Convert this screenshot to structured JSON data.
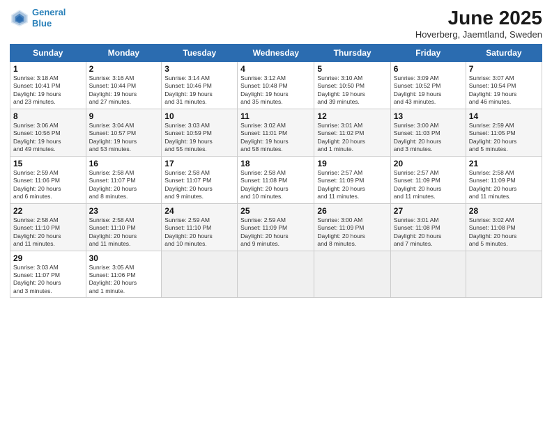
{
  "header": {
    "logo_line1": "General",
    "logo_line2": "Blue",
    "month": "June 2025",
    "location": "Hoverberg, Jaemtland, Sweden"
  },
  "weekdays": [
    "Sunday",
    "Monday",
    "Tuesday",
    "Wednesday",
    "Thursday",
    "Friday",
    "Saturday"
  ],
  "weeks": [
    [
      {
        "day": "1",
        "info": "Sunrise: 3:18 AM\nSunset: 10:41 PM\nDaylight: 19 hours\nand 23 minutes."
      },
      {
        "day": "2",
        "info": "Sunrise: 3:16 AM\nSunset: 10:44 PM\nDaylight: 19 hours\nand 27 minutes."
      },
      {
        "day": "3",
        "info": "Sunrise: 3:14 AM\nSunset: 10:46 PM\nDaylight: 19 hours\nand 31 minutes."
      },
      {
        "day": "4",
        "info": "Sunrise: 3:12 AM\nSunset: 10:48 PM\nDaylight: 19 hours\nand 35 minutes."
      },
      {
        "day": "5",
        "info": "Sunrise: 3:10 AM\nSunset: 10:50 PM\nDaylight: 19 hours\nand 39 minutes."
      },
      {
        "day": "6",
        "info": "Sunrise: 3:09 AM\nSunset: 10:52 PM\nDaylight: 19 hours\nand 43 minutes."
      },
      {
        "day": "7",
        "info": "Sunrise: 3:07 AM\nSunset: 10:54 PM\nDaylight: 19 hours\nand 46 minutes."
      }
    ],
    [
      {
        "day": "8",
        "info": "Sunrise: 3:06 AM\nSunset: 10:56 PM\nDaylight: 19 hours\nand 49 minutes."
      },
      {
        "day": "9",
        "info": "Sunrise: 3:04 AM\nSunset: 10:57 PM\nDaylight: 19 hours\nand 53 minutes."
      },
      {
        "day": "10",
        "info": "Sunrise: 3:03 AM\nSunset: 10:59 PM\nDaylight: 19 hours\nand 55 minutes."
      },
      {
        "day": "11",
        "info": "Sunrise: 3:02 AM\nSunset: 11:01 PM\nDaylight: 19 hours\nand 58 minutes."
      },
      {
        "day": "12",
        "info": "Sunrise: 3:01 AM\nSunset: 11:02 PM\nDaylight: 20 hours\nand 1 minute."
      },
      {
        "day": "13",
        "info": "Sunrise: 3:00 AM\nSunset: 11:03 PM\nDaylight: 20 hours\nand 3 minutes."
      },
      {
        "day": "14",
        "info": "Sunrise: 2:59 AM\nSunset: 11:05 PM\nDaylight: 20 hours\nand 5 minutes."
      }
    ],
    [
      {
        "day": "15",
        "info": "Sunrise: 2:59 AM\nSunset: 11:06 PM\nDaylight: 20 hours\nand 6 minutes."
      },
      {
        "day": "16",
        "info": "Sunrise: 2:58 AM\nSunset: 11:07 PM\nDaylight: 20 hours\nand 8 minutes."
      },
      {
        "day": "17",
        "info": "Sunrise: 2:58 AM\nSunset: 11:07 PM\nDaylight: 20 hours\nand 9 minutes."
      },
      {
        "day": "18",
        "info": "Sunrise: 2:58 AM\nSunset: 11:08 PM\nDaylight: 20 hours\nand 10 minutes."
      },
      {
        "day": "19",
        "info": "Sunrise: 2:57 AM\nSunset: 11:09 PM\nDaylight: 20 hours\nand 11 minutes."
      },
      {
        "day": "20",
        "info": "Sunrise: 2:57 AM\nSunset: 11:09 PM\nDaylight: 20 hours\nand 11 minutes."
      },
      {
        "day": "21",
        "info": "Sunrise: 2:58 AM\nSunset: 11:09 PM\nDaylight: 20 hours\nand 11 minutes."
      }
    ],
    [
      {
        "day": "22",
        "info": "Sunrise: 2:58 AM\nSunset: 11:10 PM\nDaylight: 20 hours\nand 11 minutes."
      },
      {
        "day": "23",
        "info": "Sunrise: 2:58 AM\nSunset: 11:10 PM\nDaylight: 20 hours\nand 11 minutes."
      },
      {
        "day": "24",
        "info": "Sunrise: 2:59 AM\nSunset: 11:10 PM\nDaylight: 20 hours\nand 10 minutes."
      },
      {
        "day": "25",
        "info": "Sunrise: 2:59 AM\nSunset: 11:09 PM\nDaylight: 20 hours\nand 9 minutes."
      },
      {
        "day": "26",
        "info": "Sunrise: 3:00 AM\nSunset: 11:09 PM\nDaylight: 20 hours\nand 8 minutes."
      },
      {
        "day": "27",
        "info": "Sunrise: 3:01 AM\nSunset: 11:08 PM\nDaylight: 20 hours\nand 7 minutes."
      },
      {
        "day": "28",
        "info": "Sunrise: 3:02 AM\nSunset: 11:08 PM\nDaylight: 20 hours\nand 5 minutes."
      }
    ],
    [
      {
        "day": "29",
        "info": "Sunrise: 3:03 AM\nSunset: 11:07 PM\nDaylight: 20 hours\nand 3 minutes."
      },
      {
        "day": "30",
        "info": "Sunrise: 3:05 AM\nSunset: 11:06 PM\nDaylight: 20 hours\nand 1 minute."
      },
      null,
      null,
      null,
      null,
      null
    ]
  ]
}
